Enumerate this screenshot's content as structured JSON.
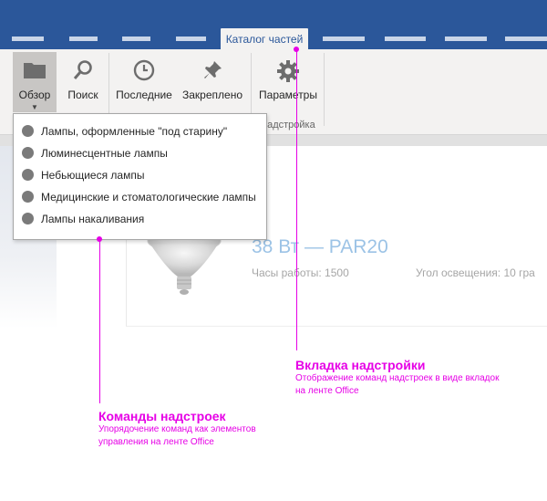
{
  "window": {
    "active_tab": "Каталог частей",
    "title_bar_color": "#2b579a"
  },
  "ribbon": {
    "buttons": [
      {
        "label": "Обзор",
        "icon": "folder-icon",
        "selected": true,
        "has_dropdown": true
      },
      {
        "label": "Поиск",
        "icon": "search-icon"
      },
      {
        "label": "Последние",
        "icon": "clock-icon"
      },
      {
        "label": "Закреплено",
        "icon": "pin-icon"
      },
      {
        "label": "Параметры",
        "icon": "gear-icon"
      }
    ],
    "group_label": "надстройка"
  },
  "dropdown": {
    "items": [
      "Лампы, оформленные \"под старину\"",
      "Люминесцентные лампы",
      "Небьющиеся лампы",
      "Медицинские и стоматологические лампы",
      "Лампы накаливания"
    ]
  },
  "product": {
    "image": "lamp-image",
    "title": "38 Вт — PAR20",
    "hours": "Часы работы: 1500",
    "angle": "Угол освещения: 10 гра"
  },
  "annotations": {
    "color": "#e600e6",
    "tab": {
      "title": "Вкладка надстройки",
      "desc_line1": "Отображение команд надстроек в виде вкладок",
      "desc_line2": "на ленте Office"
    },
    "commands": {
      "title": "Команды надстроек",
      "desc_line1": "Упорядочение команд как элементов",
      "desc_line2": "управления на ленте Office"
    }
  }
}
